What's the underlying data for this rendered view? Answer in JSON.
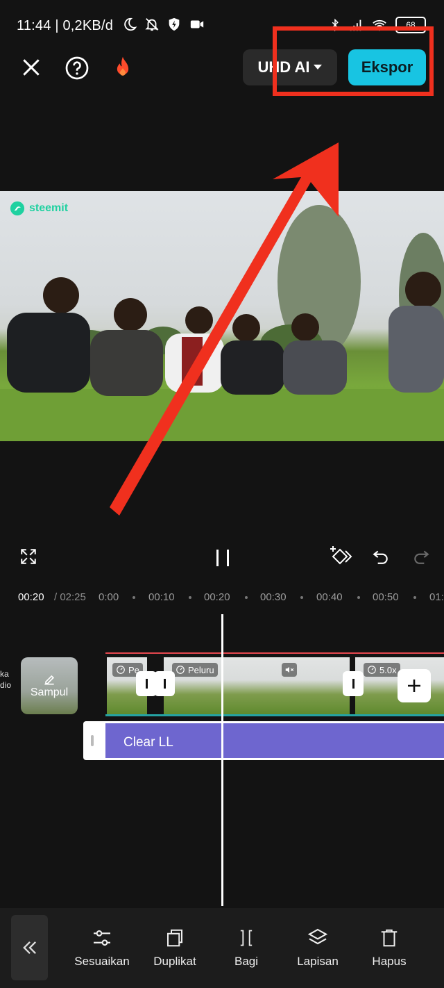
{
  "status_bar": {
    "time_speed": "11:44 | 0,2KB/d",
    "battery": "68"
  },
  "top_bar": {
    "resolution_label": "UHD AI",
    "export_label": "Ekspor"
  },
  "preview": {
    "watermark": "steemit"
  },
  "timeline": {
    "current_time": "00:20",
    "total_time": "/ 02:25",
    "ruler_labels": [
      "0:00",
      "00:10",
      "00:20",
      "00:30",
      "00:40",
      "00:50",
      "01:"
    ],
    "cover_label": "Sampul",
    "left_stub_text": "ka\ndio",
    "clips": [
      {
        "tag": "Pe"
      },
      {
        "tag": "Peluru"
      },
      {
        "tag": "5.0x"
      }
    ],
    "audio_label": "Clear LL"
  },
  "toolbar": {
    "items": [
      {
        "label": "Sesuaikan",
        "icon": "sliders-icon"
      },
      {
        "label": "Duplikat",
        "icon": "duplicate-icon"
      },
      {
        "label": "Bagi",
        "icon": "split-icon"
      },
      {
        "label": "Lapisan",
        "icon": "layers-icon"
      },
      {
        "label": "Hapus",
        "icon": "trash-icon"
      }
    ]
  },
  "colors": {
    "export_button": "#18c4e2",
    "annotation": "#f0301e",
    "audio_track": "#6e66cf",
    "background": "#131313"
  }
}
